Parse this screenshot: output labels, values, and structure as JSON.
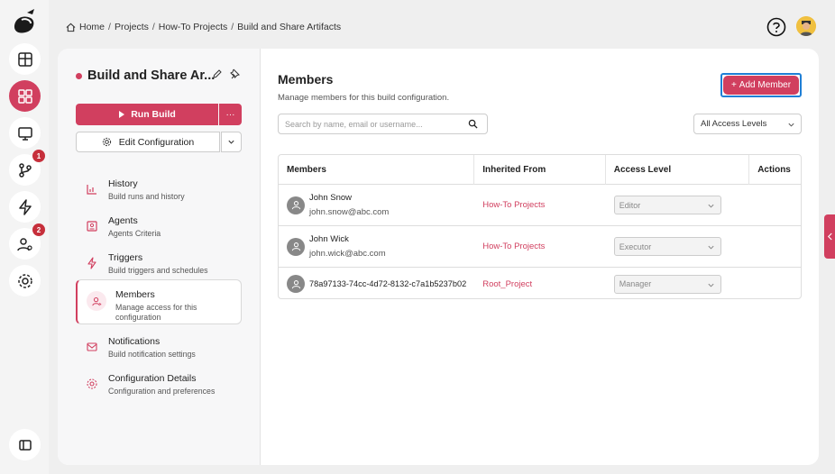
{
  "rail": {
    "items": [
      {
        "icon": "layout-grid-icon",
        "badge": ""
      },
      {
        "icon": "apps-icon",
        "badge": "",
        "active": true
      },
      {
        "icon": "monitor-icon",
        "badge": ""
      },
      {
        "icon": "git-branch-icon",
        "badge": "1"
      },
      {
        "icon": "lightning-icon",
        "badge": ""
      },
      {
        "icon": "user-settings-icon",
        "badge": "2"
      },
      {
        "icon": "gear-icon",
        "badge": ""
      }
    ],
    "bottom_icon": "sidebar-toggle-icon"
  },
  "breadcrumb": {
    "items": [
      "Home",
      "Projects",
      "How-To Projects",
      "Build and Share Artifacts"
    ]
  },
  "config": {
    "title": "Build and Share Ar...",
    "run_label": "Run Build",
    "more_label": "···",
    "edit_label": "Edit Configuration"
  },
  "nav": {
    "items": [
      {
        "title": "History",
        "sub": "Build runs and history"
      },
      {
        "title": "Agents",
        "sub": "Agents Criteria"
      },
      {
        "title": "Triggers",
        "sub": "Build triggers and schedules"
      },
      {
        "title": "Members",
        "sub": "Manage access for this configuration"
      },
      {
        "title": "Notifications",
        "sub": "Build notification settings"
      },
      {
        "title": "Configuration Details",
        "sub": "Configuration and preferences"
      }
    ]
  },
  "members": {
    "title": "Members",
    "subtitle": "Manage members for this build configuration.",
    "add_label": "Add Member",
    "search_placeholder": "Search by name, email or username...",
    "access_filter": "All Access Levels",
    "columns": [
      "Members",
      "Inherited From",
      "Access Level",
      "Actions"
    ],
    "rows": [
      {
        "name": "John Snow",
        "email": "john.snow@abc.com",
        "inherited": "How-To Projects",
        "access": "Editor"
      },
      {
        "name": "John Wick",
        "email": "john.wick@abc.com",
        "inherited": "How-To Projects",
        "access": "Executor"
      },
      {
        "name": "78a97133-74cc-4d72-8132-c7a1b5237b02",
        "email": "",
        "inherited": "Root_Project",
        "access": "Manager"
      }
    ]
  },
  "colors": {
    "accent": "#d13f5f",
    "focus": "#1f7fd6"
  }
}
